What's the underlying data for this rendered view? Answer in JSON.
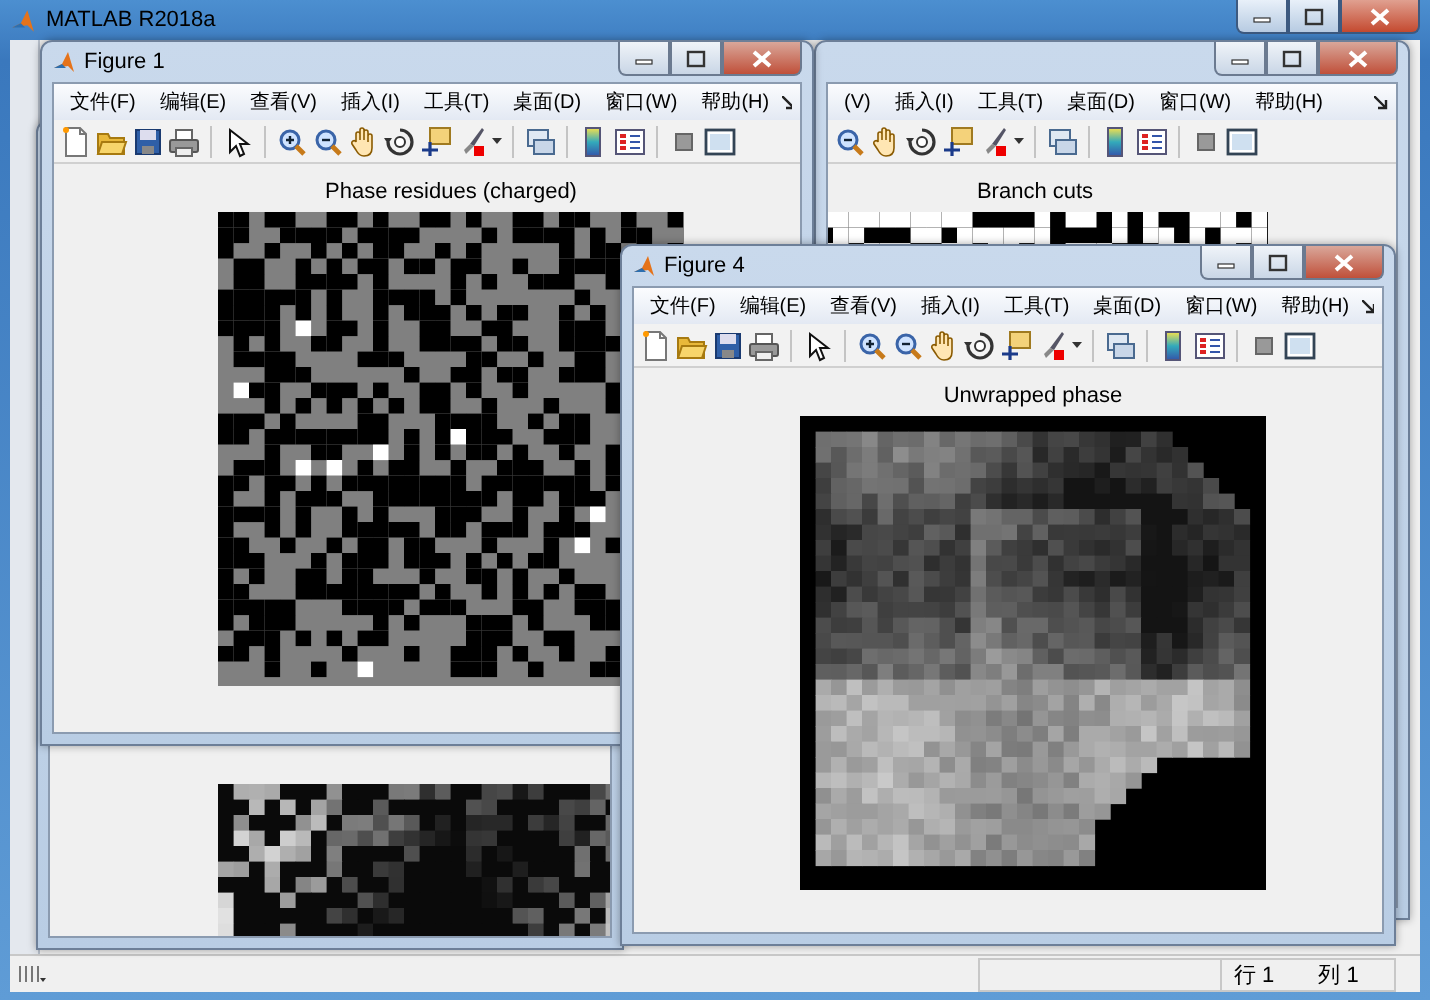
{
  "main_window": {
    "title": "MATLAB R2018a",
    "status_bar": {
      "row": "行 1",
      "column": "列 1"
    }
  },
  "windows": [
    {
      "kind": "residues",
      "title": "Figure 1",
      "menu": [
        "文件(F)",
        "编辑(E)",
        "查看(V)",
        "插入(I)",
        "工具(T)",
        "桌面(D)",
        "窗口(W)",
        "帮助(H)"
      ],
      "plot_title": "Phase residues (charged)"
    },
    {
      "kind": "branch_cuts",
      "menu": [
        "(V)",
        "插入(I)",
        "工具(T)",
        "桌面(D)",
        "窗口(W)",
        "帮助(H)"
      ],
      "plot_title": "Branch cuts"
    },
    {
      "kind": "unwrapped",
      "title": "Figure 4",
      "menu": [
        "文件(F)",
        "编辑(E)",
        "查看(V)",
        "插入(I)",
        "工具(T)",
        "桌面(D)",
        "窗口(W)",
        "帮助(H)"
      ],
      "plot_title": "Unwrapped phase"
    },
    {
      "kind": "wrapped"
    }
  ]
}
